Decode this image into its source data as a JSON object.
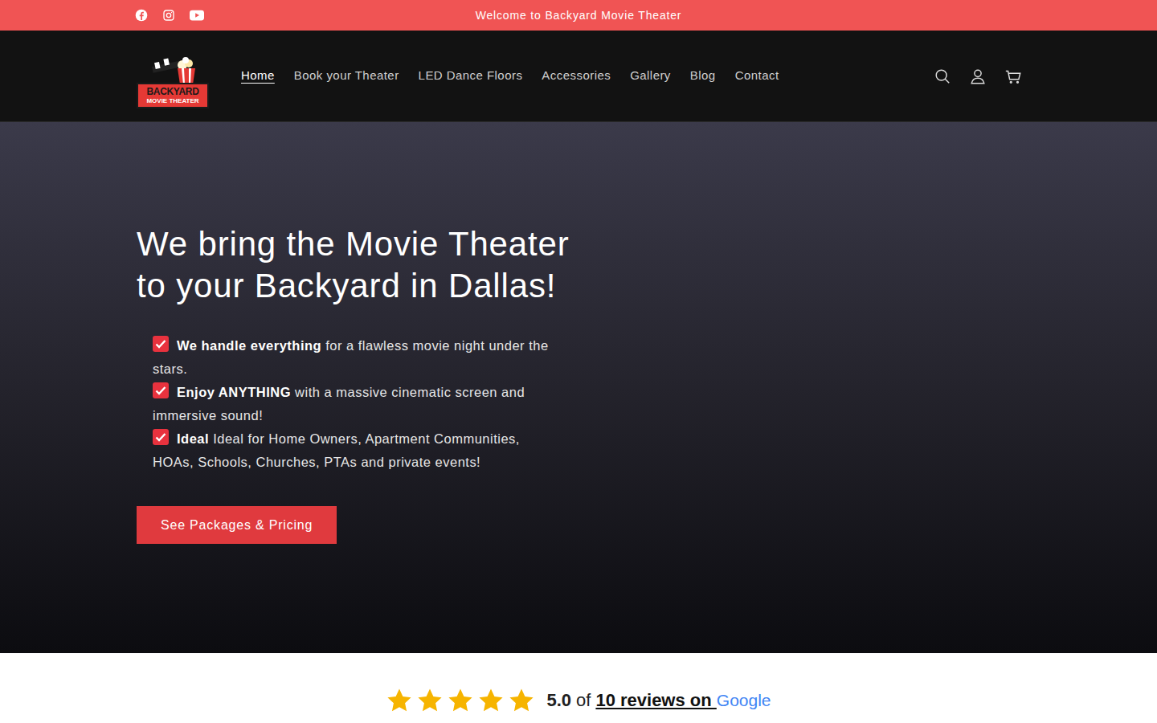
{
  "announcement": {
    "text": "Welcome to Backyard Movie Theater"
  },
  "logo": {
    "line1": "BACKYARD",
    "line2": "MOVIE THEATER"
  },
  "nav": {
    "items": [
      {
        "label": "Home",
        "selected": true
      },
      {
        "label": "Book your Theater",
        "selected": false
      },
      {
        "label": "LED Dance Floors",
        "selected": false
      },
      {
        "label": "Accessories",
        "selected": false
      },
      {
        "label": "Gallery",
        "selected": false
      },
      {
        "label": "Blog",
        "selected": false
      },
      {
        "label": "Contact",
        "selected": false
      }
    ]
  },
  "hero": {
    "heading": "We bring the Movie Theater to your Backyard in Dallas!",
    "bullets": [
      {
        "bold": "We handle everything",
        "text": " for a flawless movie night under the stars."
      },
      {
        "bold": "Enjoy ANYTHING",
        "text": " with a massive cinematic screen and immersive sound!"
      },
      {
        "bold": "Ideal",
        "text": " Ideal for Home Owners, Apartment Communities, HOAs, Schools, Churches, PTAs and private events!"
      }
    ],
    "button": "See Packages & Pricing"
  },
  "reviews": {
    "stars": 5,
    "rating": "5.0",
    "of": "of",
    "link": "10 reviews on ",
    "brand": "Google"
  }
}
